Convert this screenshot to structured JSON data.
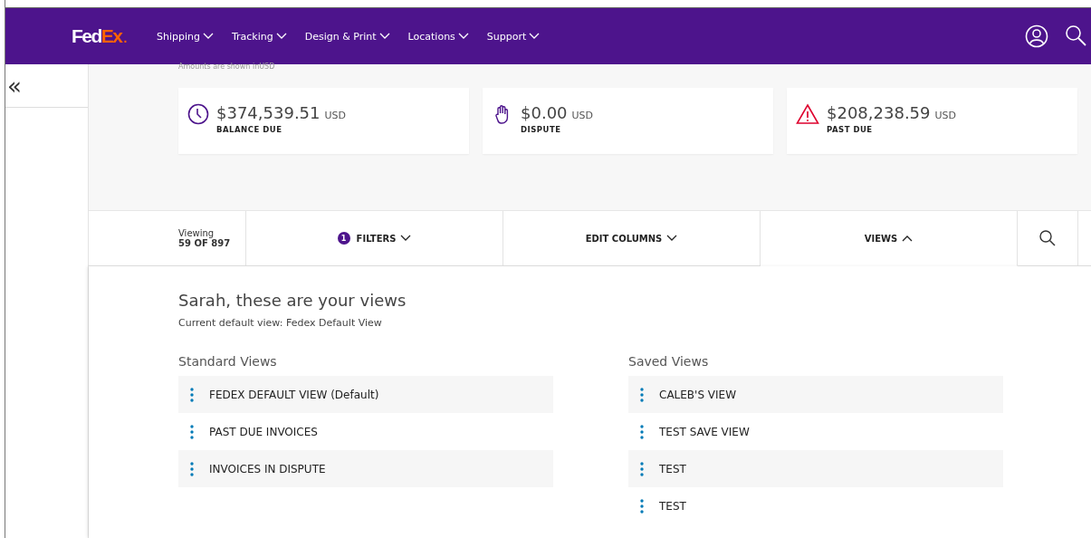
{
  "header": {
    "logo": {
      "primary": "Fed",
      "accent": "Ex",
      "dot": "."
    },
    "nav": [
      {
        "label": "Shipping"
      },
      {
        "label": "Tracking"
      },
      {
        "label": "Design & Print"
      },
      {
        "label": "Locations"
      },
      {
        "label": "Support"
      }
    ]
  },
  "sidebar": {
    "collapse": "«"
  },
  "summary": {
    "note": "Amounts are shown inUSD",
    "cards": [
      {
        "kind": "clock",
        "amount": "$374,539.51",
        "currency": "USD",
        "label": "BALANCE DUE"
      },
      {
        "kind": "hand",
        "amount": "$0.00",
        "currency": "USD",
        "label": "DISPUTE"
      },
      {
        "kind": "warning",
        "amount": "$208,238.59",
        "currency": "USD",
        "label": "PAST DUE"
      }
    ]
  },
  "toolbar": {
    "viewing_label": "Viewing",
    "viewing_count": "59 OF 897",
    "tabs": [
      {
        "label": "FILTERS",
        "badge": "1",
        "expanded": false
      },
      {
        "label": "EDIT COLUMNS",
        "expanded": false
      },
      {
        "label": "VIEWS",
        "expanded": true
      }
    ]
  },
  "views_panel": {
    "title": "Sarah, these are your views",
    "subtitle": "Current default view: Fedex Default View",
    "groups": [
      {
        "title": "Standard Views",
        "items": [
          "FEDEX DEFAULT VIEW (Default)",
          "PAST DUE INVOICES",
          "INVOICES IN DISPUTE"
        ]
      },
      {
        "title": "Saved Views",
        "items": [
          "CALEB'S VIEW",
          "TEST SAVE VIEW",
          "TEST",
          "TEST"
        ]
      }
    ]
  }
}
